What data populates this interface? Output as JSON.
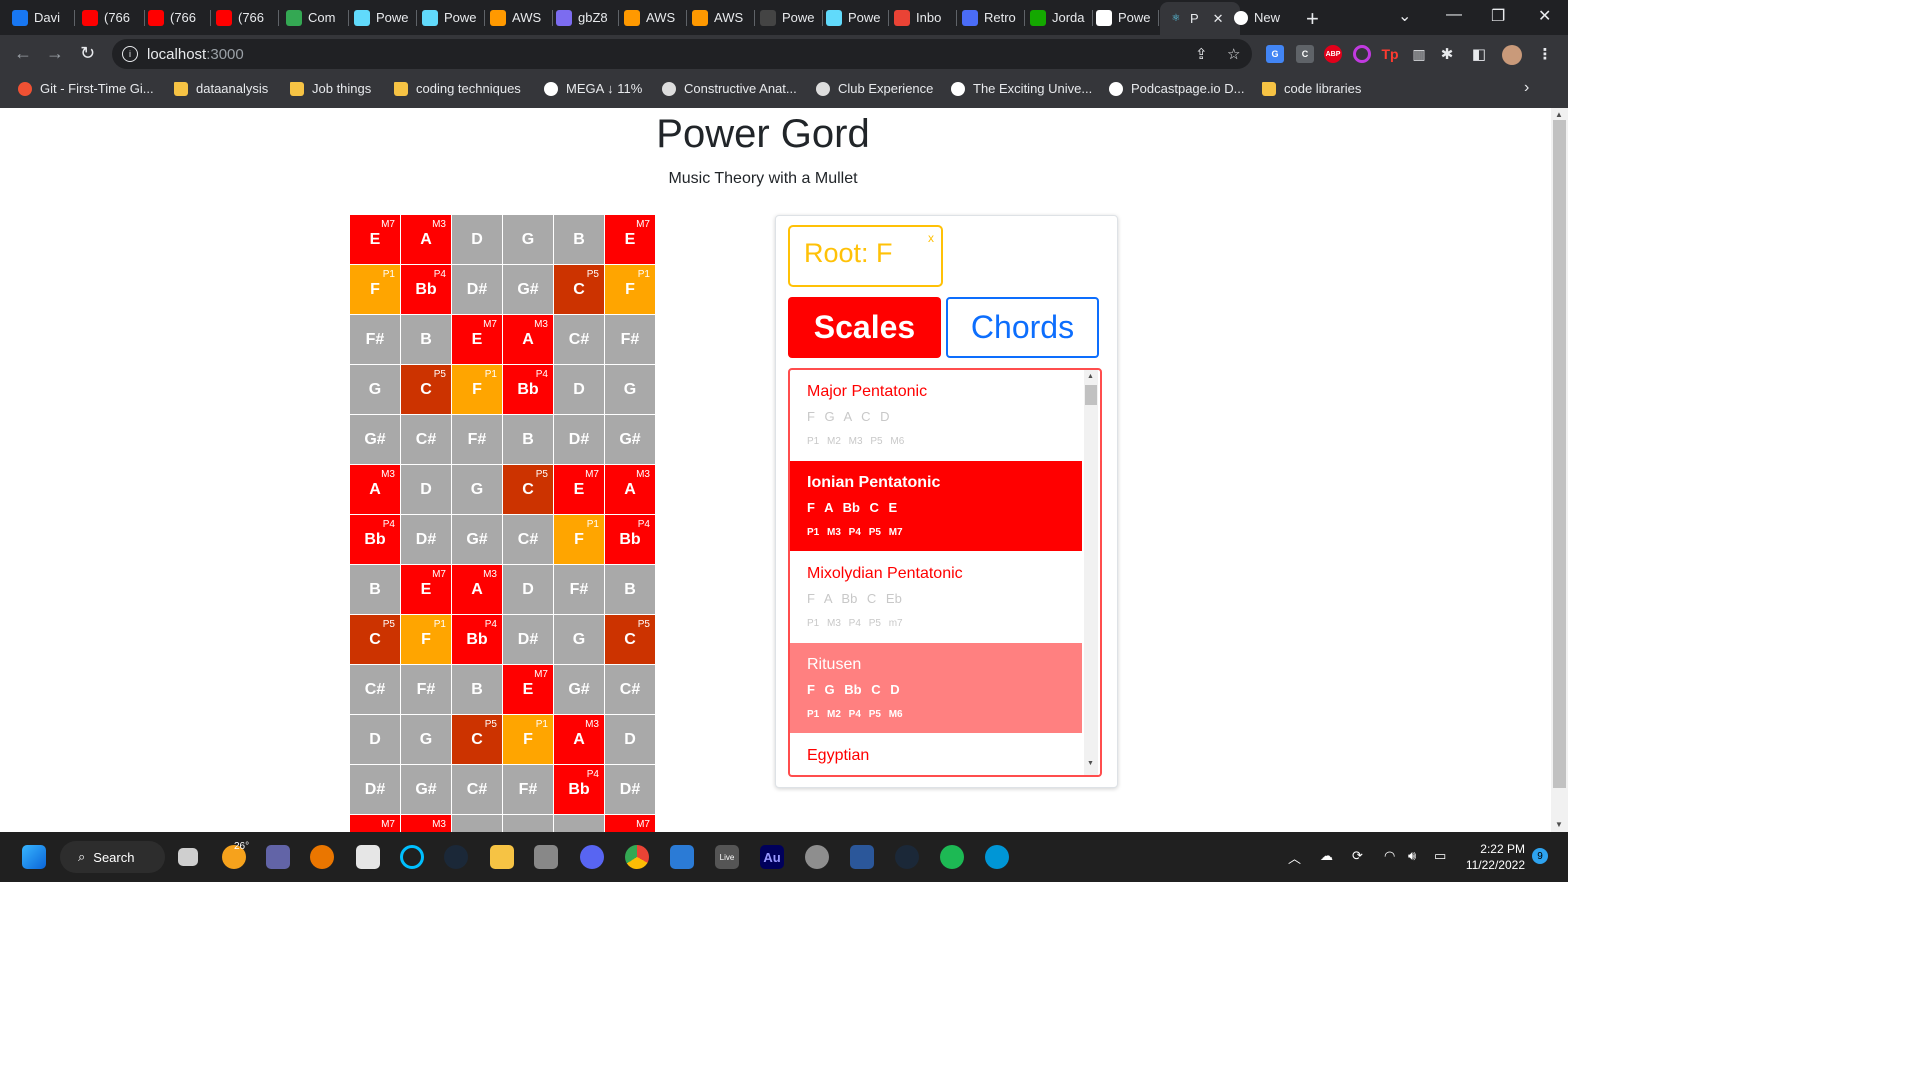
{
  "browser": {
    "tabs": [
      {
        "label": "Davi",
        "icon": "facebook-icon",
        "color": "#1877f2"
      },
      {
        "label": "(766",
        "icon": "youtube-icon",
        "color": "#ff0000"
      },
      {
        "label": "(766",
        "icon": "youtube-icon",
        "color": "#ff0000"
      },
      {
        "label": "(766",
        "icon": "youtube-icon",
        "color": "#ff0000"
      },
      {
        "label": "Com",
        "icon": "google-drive-icon",
        "color": "#34a853"
      },
      {
        "label": "Powe",
        "icon": "react-icon",
        "color": "#61dafb"
      },
      {
        "label": "Powe",
        "icon": "react-icon",
        "color": "#61dafb"
      },
      {
        "label": "AWS",
        "icon": "aws-icon",
        "color": "#ff9900"
      },
      {
        "label": "gbZ8",
        "icon": "sparkle-icon",
        "color": "#7c6cf0"
      },
      {
        "label": "AWS",
        "icon": "aws-icon",
        "color": "#ff9900"
      },
      {
        "label": "AWS",
        "icon": "aws-icon",
        "color": "#ff9900"
      },
      {
        "label": "Powe",
        "icon": "github-icon",
        "color": "#444444"
      },
      {
        "label": "Powe",
        "icon": "react-icon",
        "color": "#61dafb"
      },
      {
        "label": "Inbo",
        "icon": "gmail-icon",
        "color": "#ea4335"
      },
      {
        "label": "Retro",
        "icon": "retro-icon",
        "color": "#4a6cf7"
      },
      {
        "label": "Jorda",
        "icon": "upwork-icon",
        "color": "#14a800"
      },
      {
        "label": "Powe",
        "icon": "dots-icon",
        "color": "#ffffff"
      }
    ],
    "active_tab": {
      "label": "P",
      "icon": "react-icon"
    },
    "extra_tab": {
      "label": "New",
      "icon": "chrome-icon"
    },
    "url_host": "localhost",
    "url_port": ":3000",
    "bookmarks": [
      {
        "label": "Git - First-Time Gi...",
        "icon": "git-icon",
        "color": "#f05133"
      },
      {
        "label": "dataanalysis",
        "icon": "folder-icon",
        "color": "#f6c344"
      },
      {
        "label": "Job things",
        "icon": "folder-icon",
        "color": "#f6c344"
      },
      {
        "label": "coding techniques",
        "icon": "folder-icon",
        "color": "#f6c344"
      },
      {
        "label": "MEGA ↓ 11%",
        "icon": "mega-icon",
        "color": "#ffffff"
      },
      {
        "label": "Constructive Anat...",
        "icon": "book-icon",
        "color": "#dddddd"
      },
      {
        "label": "Club Experience",
        "icon": "club-icon",
        "color": "#dddddd"
      },
      {
        "label": "The Exciting Unive...",
        "icon": "library-icon",
        "color": "#ffffff"
      },
      {
        "label": "Podcastpage.io D...",
        "icon": "podcast-icon",
        "color": "#ffffff"
      },
      {
        "label": "code libraries",
        "icon": "folder-icon",
        "color": "#f6c344"
      }
    ]
  },
  "app": {
    "title": "Power Gord",
    "subtitle": "Music Theory with a Mullet",
    "root_label": "Root: F",
    "root_close": "x",
    "scales_button": "Scales",
    "chords_button": "Chords",
    "colors": {
      "in_scale": "#ff0000",
      "root": "#ffa500",
      "fifth": "#cc3300",
      "out_of_scale": "#a9a9a9",
      "root_accent": "#ffc107",
      "chords_blue": "#0d6efd"
    },
    "fretboard": [
      [
        [
          "E",
          "M7",
          "r"
        ],
        [
          "A",
          "M3",
          "r"
        ],
        [
          "D",
          "",
          "g"
        ],
        [
          "G",
          "",
          "g"
        ],
        [
          "B",
          "",
          "g"
        ],
        [
          "E",
          "M7",
          "r"
        ]
      ],
      [
        [
          "F",
          "P1",
          "o"
        ],
        [
          "Bb",
          "P4",
          "r"
        ],
        [
          "D#",
          "",
          "g"
        ],
        [
          "G#",
          "",
          "g"
        ],
        [
          "C",
          "P5",
          "c"
        ],
        [
          "F",
          "P1",
          "o"
        ]
      ],
      [
        [
          "F#",
          "",
          "g"
        ],
        [
          "B",
          "",
          "g"
        ],
        [
          "E",
          "M7",
          "r"
        ],
        [
          "A",
          "M3",
          "r"
        ],
        [
          "C#",
          "",
          "g"
        ],
        [
          "F#",
          "",
          "g"
        ]
      ],
      [
        [
          "G",
          "",
          "g"
        ],
        [
          "C",
          "P5",
          "c"
        ],
        [
          "F",
          "P1",
          "o"
        ],
        [
          "Bb",
          "P4",
          "r"
        ],
        [
          "D",
          "",
          "g"
        ],
        [
          "G",
          "",
          "g"
        ]
      ],
      [
        [
          "G#",
          "",
          "g"
        ],
        [
          "C#",
          "",
          "g"
        ],
        [
          "F#",
          "",
          "g"
        ],
        [
          "B",
          "",
          "g"
        ],
        [
          "D#",
          "",
          "g"
        ],
        [
          "G#",
          "",
          "g"
        ]
      ],
      [
        [
          "A",
          "M3",
          "r"
        ],
        [
          "D",
          "",
          "g"
        ],
        [
          "G",
          "",
          "g"
        ],
        [
          "C",
          "P5",
          "c"
        ],
        [
          "E",
          "M7",
          "r"
        ],
        [
          "A",
          "M3",
          "r"
        ]
      ],
      [
        [
          "Bb",
          "P4",
          "r"
        ],
        [
          "D#",
          "",
          "g"
        ],
        [
          "G#",
          "",
          "g"
        ],
        [
          "C#",
          "",
          "g"
        ],
        [
          "F",
          "P1",
          "o"
        ],
        [
          "Bb",
          "P4",
          "r"
        ]
      ],
      [
        [
          "B",
          "",
          "g"
        ],
        [
          "E",
          "M7",
          "r"
        ],
        [
          "A",
          "M3",
          "r"
        ],
        [
          "D",
          "",
          "g"
        ],
        [
          "F#",
          "",
          "g"
        ],
        [
          "B",
          "",
          "g"
        ]
      ],
      [
        [
          "C",
          "P5",
          "c"
        ],
        [
          "F",
          "P1",
          "o"
        ],
        [
          "Bb",
          "P4",
          "r"
        ],
        [
          "D#",
          "",
          "g"
        ],
        [
          "G",
          "",
          "g"
        ],
        [
          "C",
          "P5",
          "c"
        ]
      ],
      [
        [
          "C#",
          "",
          "g"
        ],
        [
          "F#",
          "",
          "g"
        ],
        [
          "B",
          "",
          "g"
        ],
        [
          "E",
          "M7",
          "r"
        ],
        [
          "G#",
          "",
          "g"
        ],
        [
          "C#",
          "",
          "g"
        ]
      ],
      [
        [
          "D",
          "",
          "g"
        ],
        [
          "G",
          "",
          "g"
        ],
        [
          "C",
          "P5",
          "c"
        ],
        [
          "F",
          "P1",
          "o"
        ],
        [
          "A",
          "M3",
          "r"
        ],
        [
          "D",
          "",
          "g"
        ]
      ],
      [
        [
          "D#",
          "",
          "g"
        ],
        [
          "G#",
          "",
          "g"
        ],
        [
          "C#",
          "",
          "g"
        ],
        [
          "F#",
          "",
          "g"
        ],
        [
          "Bb",
          "P4",
          "r"
        ],
        [
          "D#",
          "",
          "g"
        ]
      ],
      [
        [
          "",
          "M7",
          "r"
        ],
        [
          "",
          "M3",
          "r"
        ],
        [
          "",
          "",
          "g"
        ],
        [
          "",
          "",
          "g"
        ],
        [
          "",
          "",
          "g"
        ],
        [
          "",
          "M7",
          "r"
        ]
      ]
    ],
    "scales": [
      {
        "name": "Major Pentatonic",
        "notes": "F G A C D",
        "intervals": "P1 M2 M3 P5 M6",
        "state": "plain"
      },
      {
        "name": "Ionian Pentatonic",
        "notes": "F A Bb C E",
        "intervals": "P1 M3 P4 P5 M7",
        "state": "sel"
      },
      {
        "name": "Mixolydian Pentatonic",
        "notes": "F A Bb C Eb",
        "intervals": "P1 M3 P4 P5 m7",
        "state": "plain"
      },
      {
        "name": "Ritusen",
        "notes": "F G Bb C D",
        "intervals": "P1 M2 P4 P5 M6",
        "state": "semi"
      },
      {
        "name": "Egyptian",
        "notes": "",
        "intervals": "",
        "state": "plain"
      }
    ]
  },
  "taskbar": {
    "search_label": "Search",
    "weather": "26°",
    "time": "2:22 PM",
    "date": "11/22/2022",
    "notifications": "9",
    "live_label": "Live",
    "au_label": "Au"
  }
}
